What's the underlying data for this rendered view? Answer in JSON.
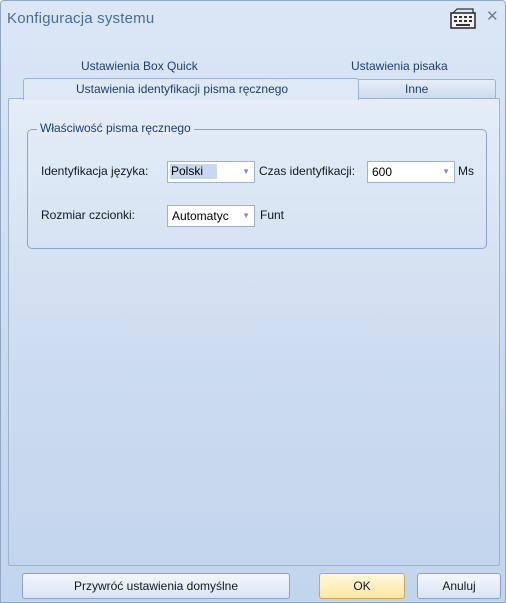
{
  "window": {
    "title": "Konfiguracja systemu",
    "icons": [
      "keyboard-icon",
      "close-icon"
    ]
  },
  "tabs": {
    "row_top": [
      "Ustawienia Box Quick",
      "Ustawienia pisaka"
    ],
    "active": "Ustawienia identyfikacji pisma ręcznego",
    "other": "Inne"
  },
  "group": {
    "title": "Właściwość pisma ręcznego",
    "language_label": "Identyfikacja języka:",
    "language_value": "Polski",
    "time_label": "Czas identyfikacji:",
    "time_value": "600",
    "time_unit": "Ms",
    "font_label": "Rozmiar czcionki:",
    "font_value": "Automatyc",
    "font_unit": "Funt"
  },
  "buttons": {
    "reset": "Przywróć ustawienia domyślne",
    "ok": "OK",
    "cancel": "Anuluj"
  }
}
